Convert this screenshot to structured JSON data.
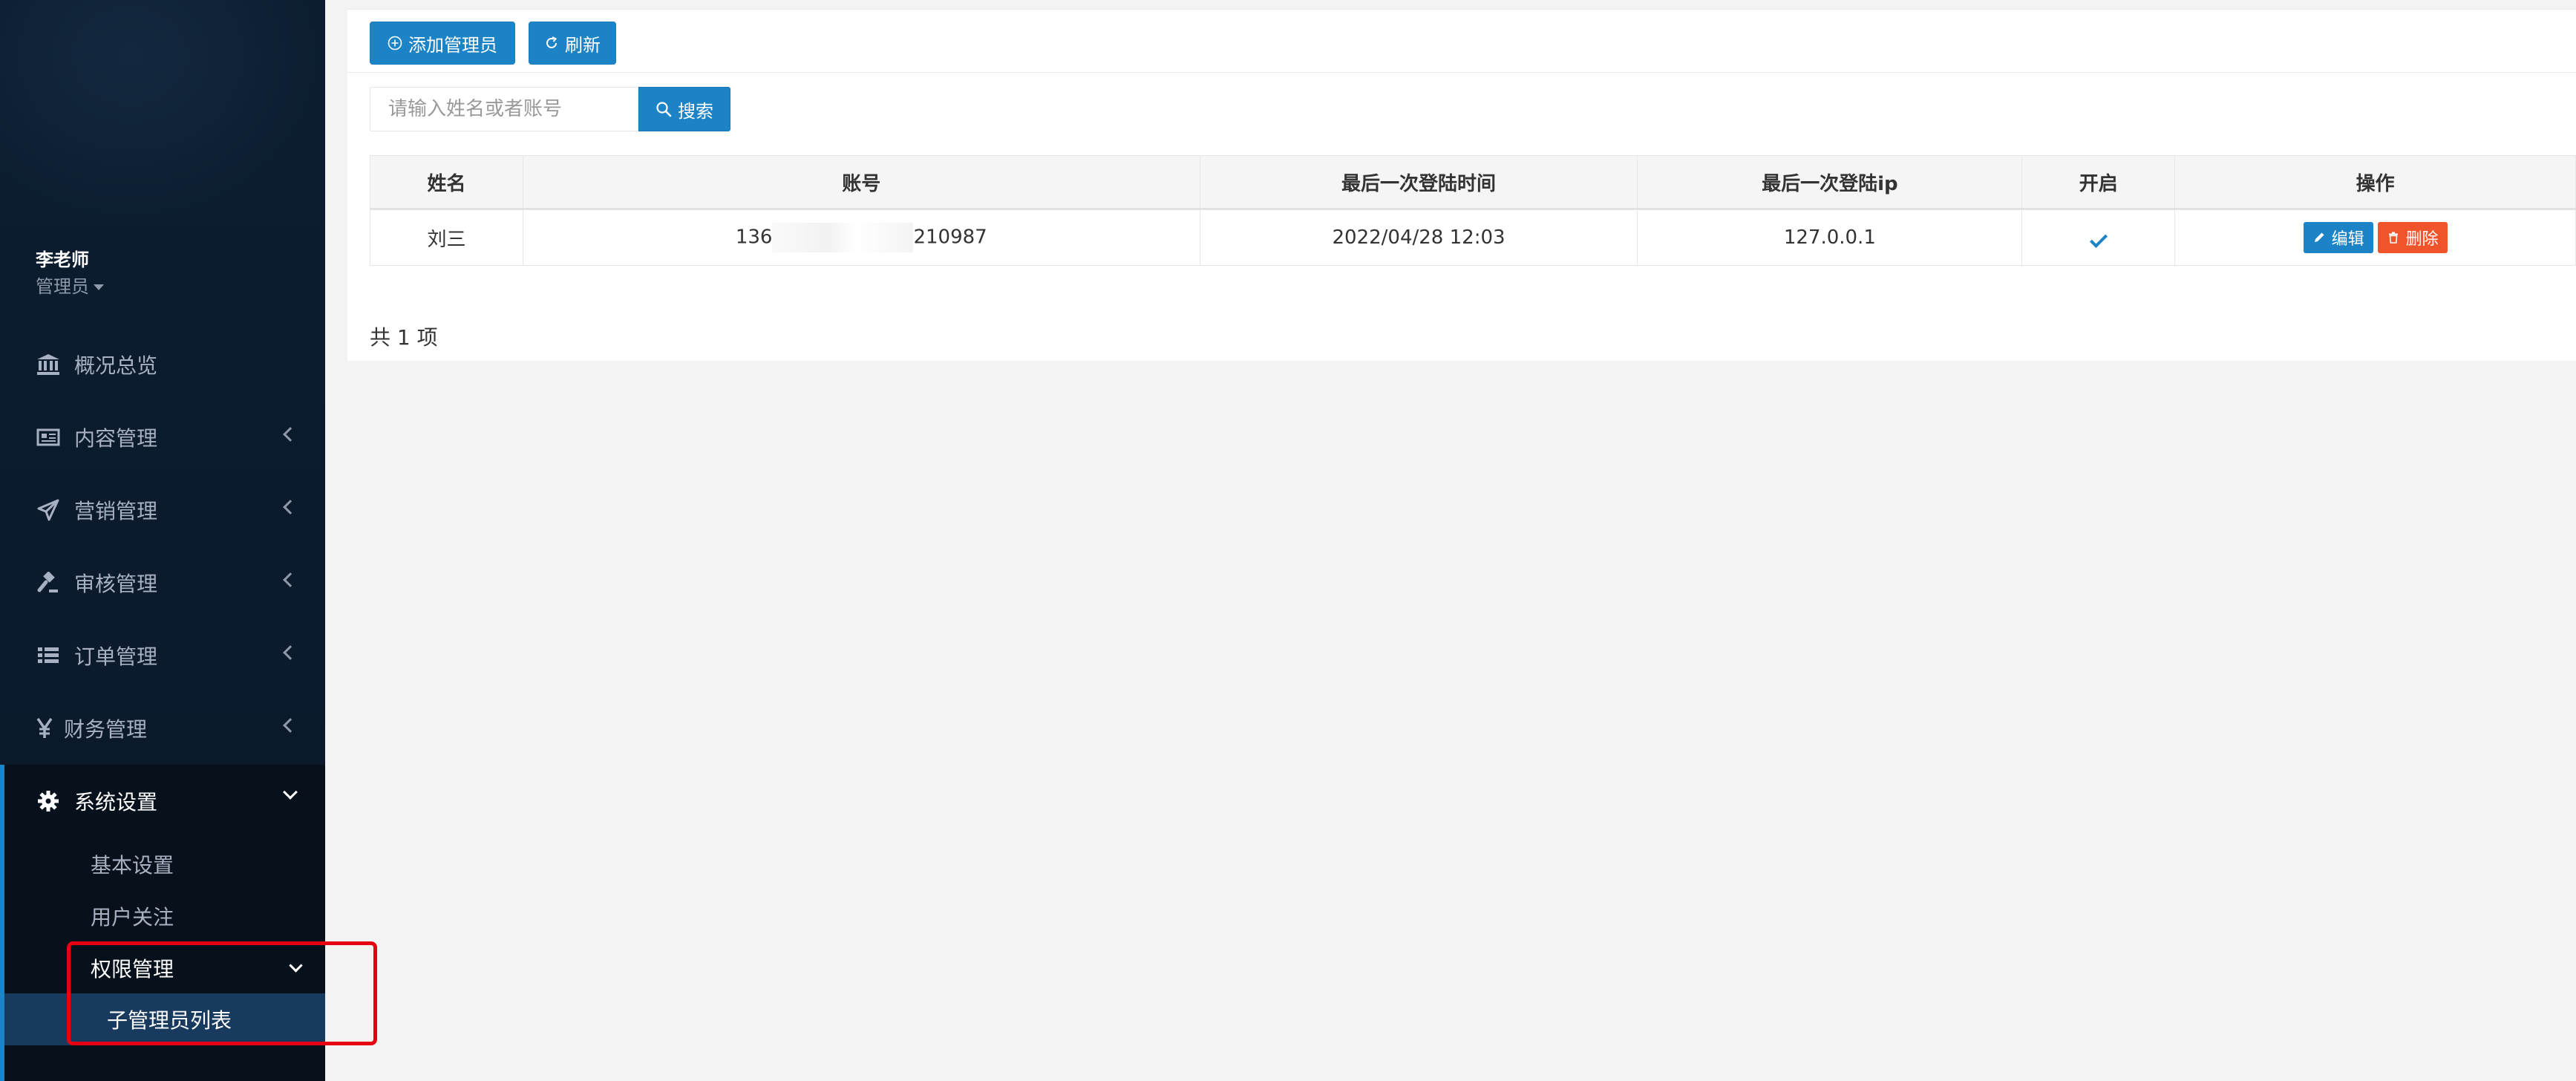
{
  "sidebar": {
    "profile": {
      "name": "李老师",
      "role": "管理员"
    },
    "items": [
      {
        "label": "概况总览",
        "icon": "bank-icon"
      },
      {
        "label": "内容管理",
        "icon": "newspaper-icon"
      },
      {
        "label": "营销管理",
        "icon": "paper-plane-icon"
      },
      {
        "label": "审核管理",
        "icon": "gavel-icon"
      },
      {
        "label": "订单管理",
        "icon": "list-icon"
      },
      {
        "label": "财务管理",
        "icon": "yen-icon"
      },
      {
        "label": "系统设置",
        "icon": "gear-icon"
      }
    ],
    "sub_items": [
      "基本设置",
      "用户关注",
      "权限管理"
    ],
    "active_leaf": "子管理员列表"
  },
  "toolbar": {
    "add_label": "添加管理员",
    "refresh_label": "刷新"
  },
  "search": {
    "placeholder": "请输入姓名或者账号",
    "button_label": "搜索"
  },
  "table": {
    "headers": [
      "姓名",
      "账号",
      "最后一次登陆时间",
      "最后一次登陆ip",
      "开启",
      "操作"
    ],
    "rows": [
      {
        "name": "刘三",
        "account_prefix": "136",
        "account_suffix": "210987",
        "last_login_time": "2022/04/28 12:03",
        "last_login_ip": "127.0.0.1",
        "enabled": true,
        "edit_label": "编辑",
        "delete_label": "删除"
      }
    ]
  },
  "footer": {
    "total": "共 1 项"
  },
  "colors": {
    "sidebar_bg": "#0c1d31",
    "primary": "#1c84c6",
    "danger": "#f0542b",
    "highlight": "#e60012"
  }
}
